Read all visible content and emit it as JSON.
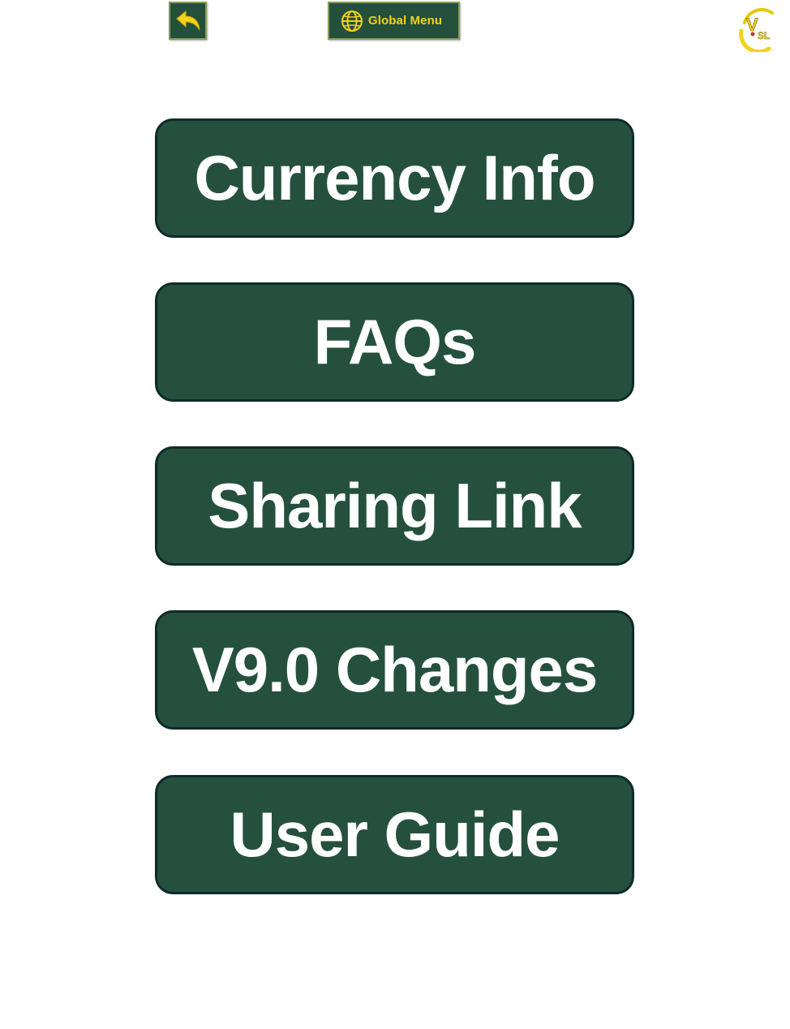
{
  "toolbar": {
    "back_icon": "undo-arrow-icon",
    "global_menu_icon": "globe-icon",
    "global_menu_label": "Global Menu",
    "logo_icon": "vsl-logo-icon",
    "logo_text_v": "V",
    "logo_text_sl": "SL"
  },
  "menu": {
    "items": [
      {
        "label": "Currency Info"
      },
      {
        "label": "FAQs"
      },
      {
        "label": "Sharing Link"
      },
      {
        "label": "V9.0 Changes"
      },
      {
        "label": "User Guide"
      }
    ]
  },
  "colors": {
    "button_bg": "#25503e",
    "button_border": "#0f2a2a",
    "button_text": "#ffffff",
    "accent_yellow": "#f2d21a",
    "page_bg": "#ffffff"
  }
}
